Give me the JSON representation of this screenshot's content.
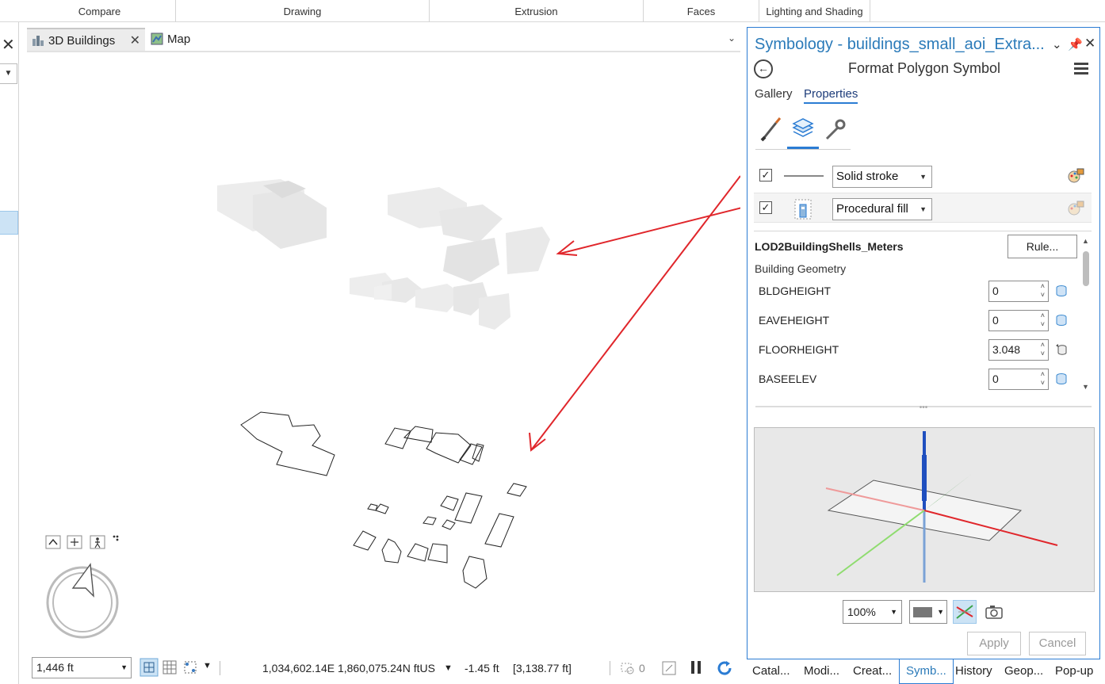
{
  "ribbon": {
    "groups": [
      "Compare",
      "Drawing",
      "Extrusion",
      "Faces",
      "Lighting and Shading"
    ]
  },
  "map_tabs": [
    {
      "label": "3D Buildings",
      "icon": "scene-icon",
      "closable": true
    },
    {
      "label": "Map",
      "icon": "map-icon",
      "closable": false
    }
  ],
  "status": {
    "scale": "1,446 ft",
    "coords": "1,034,602.14E 1,860,075.24N ftUS",
    "elevation": "-1.45 ft",
    "distance": "[3,138.77 ft]",
    "selected_count": "0"
  },
  "pane": {
    "title": "Symbology - buildings_small_aoi_Extra...",
    "subtitle": "Format Polygon Symbol",
    "tabs": [
      "Gallery",
      "Properties"
    ],
    "layers": [
      {
        "checked": true,
        "type": "Solid stroke"
      },
      {
        "checked": true,
        "type": "Procedural fill"
      }
    ],
    "rule_name": "LOD2BuildingShells_Meters",
    "rule_button": "Rule...",
    "group_label": "Building Geometry",
    "params": [
      {
        "name": "BLDGHEIGHT",
        "value": "0"
      },
      {
        "name": "EAVEHEIGHT",
        "value": "0"
      },
      {
        "name": "FLOORHEIGHT",
        "value": "3.048"
      },
      {
        "name": "BASEELEV",
        "value": "0"
      }
    ],
    "zoom": "100%",
    "apply": "Apply",
    "cancel": "Cancel"
  },
  "bottom_tabs": [
    "Catal...",
    "Modi...",
    "Creat...",
    "Symb...",
    "History",
    "Geop...",
    "Pop-up"
  ],
  "colors": {
    "accent": "#2b7cd3",
    "annotation_arrow": "#e0262b",
    "selection": "#cce3f5"
  }
}
